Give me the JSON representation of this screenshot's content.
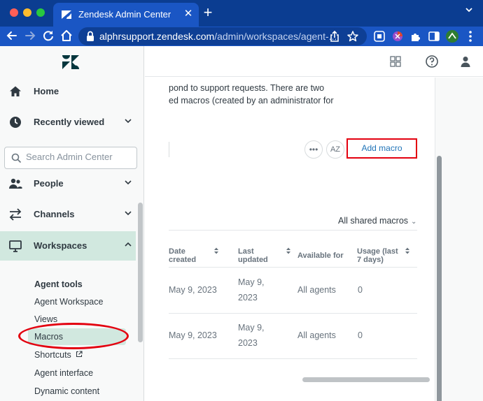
{
  "browser": {
    "tab_title": "Zendesk Admin Center",
    "tab_close": "✕",
    "new_tab": "+",
    "url_host": "alphrsupport.zendesk.com",
    "url_path": "/admin/workspaces/agent-...",
    "accent_color": "#1a56c4"
  },
  "sidebar": {
    "home": "Home",
    "recently_viewed": "Recently viewed",
    "search_placeholder": "Search Admin Center",
    "people": "People",
    "channels": "Channels",
    "workspaces": "Workspaces",
    "agent_tools_heading": "Agent tools",
    "sub_items": [
      "Agent Workspace",
      "Views",
      "Macros",
      "Shortcuts",
      "Agent interface",
      "Dynamic content"
    ],
    "selected_item": "Macros"
  },
  "main": {
    "description_line1": "pond to support requests. There are two",
    "description_line2": "ed macros (created by an administrator for",
    "more_button": "•••",
    "sort_button": "AZ",
    "add_macro_label": "Add macro",
    "filter_label": "All shared macros",
    "filter_chevron": "⌄",
    "table": {
      "headers": [
        [
          "Date",
          "created"
        ],
        [
          "Last",
          "updated"
        ],
        [
          "Available for"
        ],
        [
          "Usage (last",
          "7 days)"
        ]
      ],
      "rows": [
        {
          "date_created": "May 9, 2023",
          "last_updated_1": "May 9,",
          "last_updated_2": "2023",
          "available_for": "All agents",
          "usage": "0"
        },
        {
          "date_created": "May 9, 2023",
          "last_updated_1": "May 9,",
          "last_updated_2": "2023",
          "available_for": "All agents",
          "usage": "0"
        }
      ]
    }
  }
}
